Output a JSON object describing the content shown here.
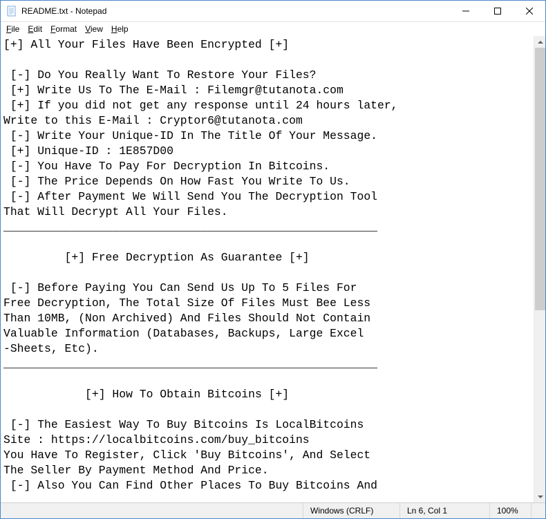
{
  "window": {
    "title": "README.txt - Notepad"
  },
  "menu": {
    "file": "File",
    "edit": "Edit",
    "format": "Format",
    "view": "View",
    "help": "Help"
  },
  "document": {
    "text": "[+] All Your Files Have Been Encrypted [+]\n\n [-] Do You Really Want To Restore Your Files?\n [+] Write Us To The E-Mail : Filemgr@tutanota.com\n [+] If you did not get any response until 24 hours later,\nWrite to this E-Mail : Cryptor6@tutanota.com\n [-] Write Your Unique-ID In The Title Of Your Message.\n [+] Unique-ID : 1E857D00\n [-] You Have To Pay For Decryption In Bitcoins.\n [-] The Price Depends On How Fast You Write To Us.\n [-] After Payment We Will Send You The Decryption Tool\nThat Will Decrypt All Your Files.\n_______________________________________________________\n\n         [+] Free Decryption As Guarantee [+]\n\n [-] Before Paying You Can Send Us Up To 5 Files For\nFree Decryption, The Total Size Of Files Must Bee Less\nThan 10MB, (Non Archived) And Files Should Not Contain\nValuable Information (Databases, Backups, Large Excel\n-Sheets, Etc).\n_______________________________________________________\n\n            [+] How To Obtain Bitcoins [+]\n\n [-] The Easiest Way To Buy Bitcoins Is LocalBitcoins\nSite : https://localbitcoins.com/buy_bitcoins\nYou Have To Register, Click 'Buy Bitcoins', And Select\nThe Seller By Payment Method And Price.\n [-] Also You Can Find Other Places To Buy Bitcoins And"
  },
  "statusbar": {
    "encoding": "Windows (CRLF)",
    "position": "Ln 6, Col 1",
    "zoom": "100%"
  }
}
